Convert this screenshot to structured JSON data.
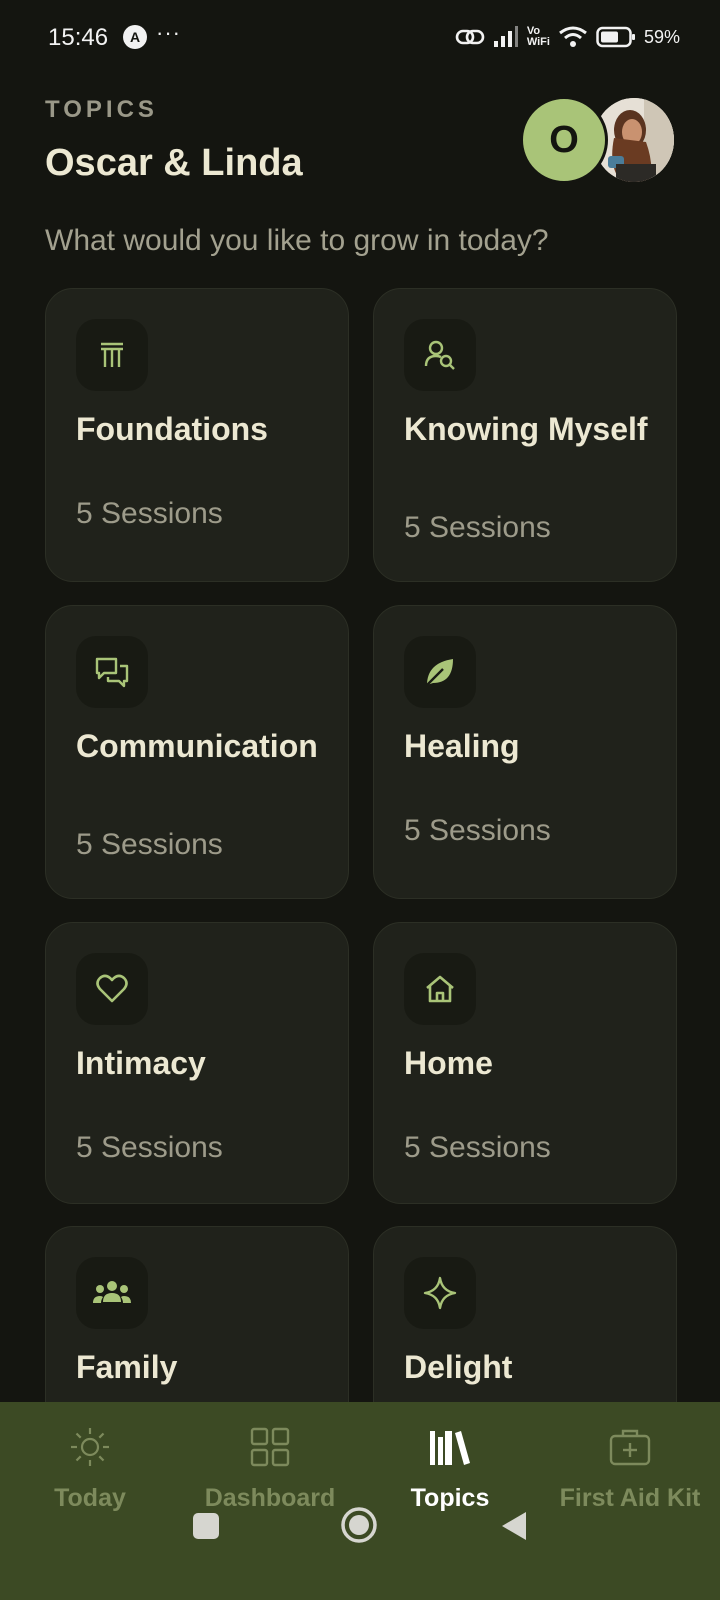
{
  "status_bar": {
    "time": "15:46",
    "app_indicator": "A",
    "more": "···",
    "vowifi_top": "Vo",
    "vowifi_bottom": "WiFi",
    "battery_percent": "59%"
  },
  "header": {
    "eyebrow": "TOPICS",
    "title": "Oscar & Linda",
    "avatar_initial": "O",
    "prompt": "What would you like to grow in today?"
  },
  "topics": [
    {
      "title": "Foundations",
      "sessions": "5 Sessions",
      "icon": "columns-icon"
    },
    {
      "title": "Knowing Myself",
      "sessions": "5 Sessions",
      "icon": "person-search-icon"
    },
    {
      "title": "Communication",
      "sessions": "5 Sessions",
      "icon": "chat-bubbles-icon"
    },
    {
      "title": "Healing",
      "sessions": "5 Sessions",
      "icon": "leaf-icon"
    },
    {
      "title": "Intimacy",
      "sessions": "5 Sessions",
      "icon": "heart-icon"
    },
    {
      "title": "Home",
      "sessions": "5 Sessions",
      "icon": "home-icon"
    },
    {
      "title": "Family",
      "sessions": "",
      "icon": "group-icon"
    },
    {
      "title": "Delight",
      "sessions": "",
      "icon": "sparkle-icon"
    }
  ],
  "nav": {
    "items": [
      {
        "label": "Today",
        "icon": "sun-icon",
        "active": false
      },
      {
        "label": "Dashboard",
        "icon": "grid-icon",
        "active": false
      },
      {
        "label": "Topics",
        "icon": "books-icon",
        "active": true
      },
      {
        "label": "First Aid Kit",
        "icon": "first-aid-kit-icon",
        "active": false
      }
    ]
  },
  "colors": {
    "background": "#141510",
    "card": "#20221b",
    "accent": "#a9c478",
    "nav_background": "#3c4a24"
  }
}
